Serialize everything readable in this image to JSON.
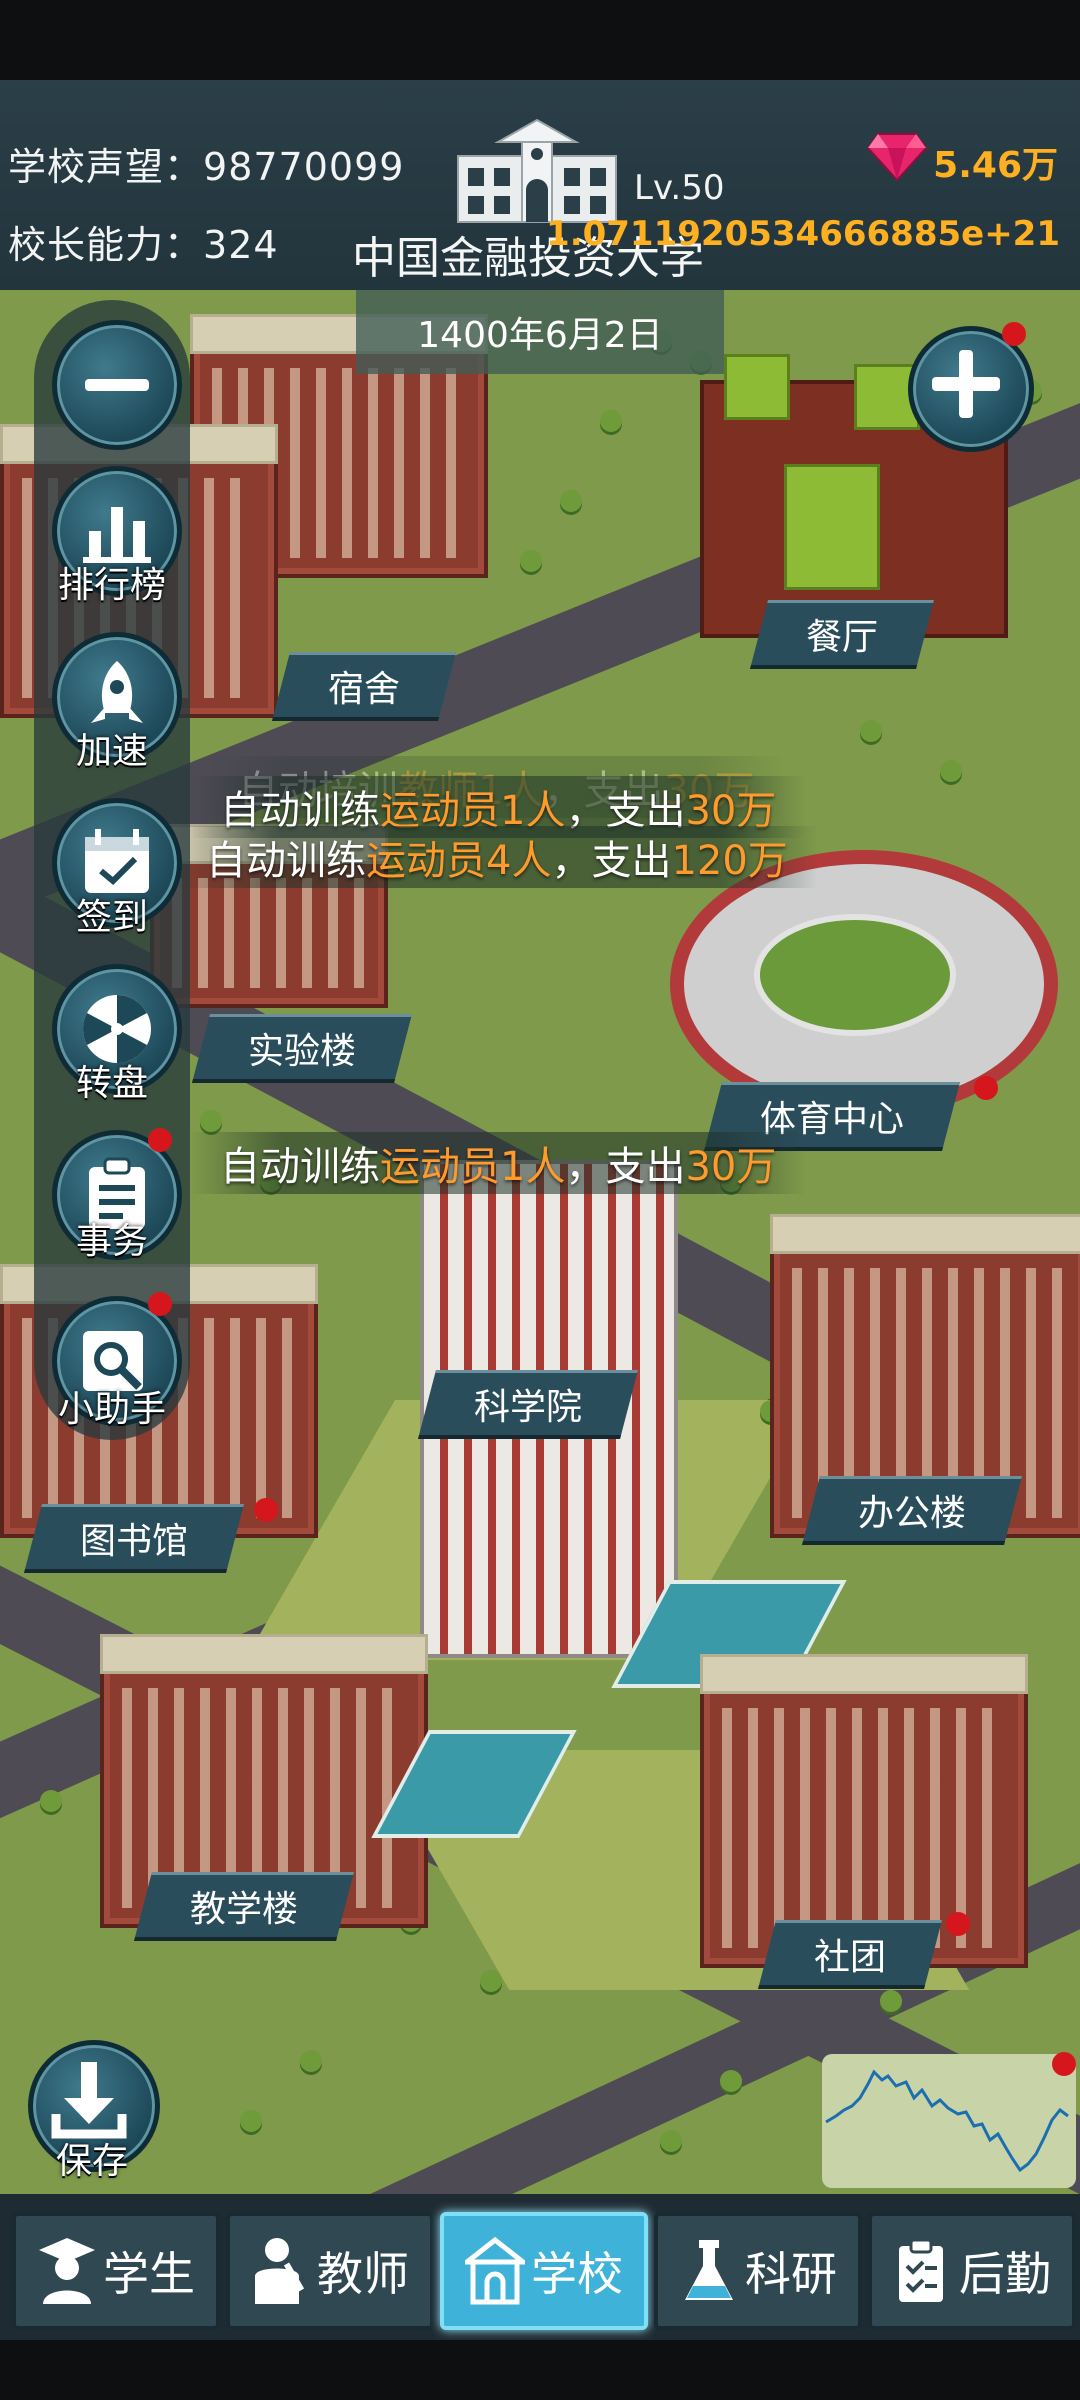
{
  "header": {
    "reputation_label": "学校声望：",
    "reputation_value": "98770099",
    "ability_label": "校长能力：",
    "ability_value": "324",
    "level": "Lv.50",
    "school_name": "中国金融投资大学",
    "gems": "5.46万",
    "money": "1.0711920534666885e+21",
    "accent_color": "#ffb020"
  },
  "date": "1400年6月2日",
  "side_menu": {
    "ranking": "排行榜",
    "speed": "加速",
    "checkin": "签到",
    "wheel": "转盘",
    "affairs": "事务",
    "helper": "小助手",
    "save": "保存"
  },
  "buildings": {
    "dorm": "宿舍",
    "canteen": "餐厅",
    "lab": "实验楼",
    "sports_center": "体育中心",
    "science_academy": "科学院",
    "office": "办公楼",
    "library": "图书馆",
    "teaching": "教学楼",
    "club": "社团"
  },
  "notices": [
    {
      "prefix": "自动培训",
      "highlight": "教师1人",
      "mid": "，支出",
      "amount": "30万"
    },
    {
      "prefix": "自动训练",
      "highlight": "运动员1人",
      "mid": "，支出",
      "amount": "30万"
    },
    {
      "prefix": "自动训练",
      "highlight": "运动员4人",
      "mid": "，支出",
      "amount": "120万"
    },
    {
      "prefix": "自动训练",
      "highlight": "运动员1人",
      "mid": "，支出",
      "amount": "30万"
    }
  ],
  "tabs": {
    "students": "学生",
    "teachers": "教师",
    "school": "学校",
    "research": "科研",
    "logistics": "后勤"
  },
  "colors": {
    "highlight": "#ff9a2c",
    "badge": "#d5171d",
    "active_tab": "#3eb2d8",
    "label_bg": "#2a4d5c"
  }
}
